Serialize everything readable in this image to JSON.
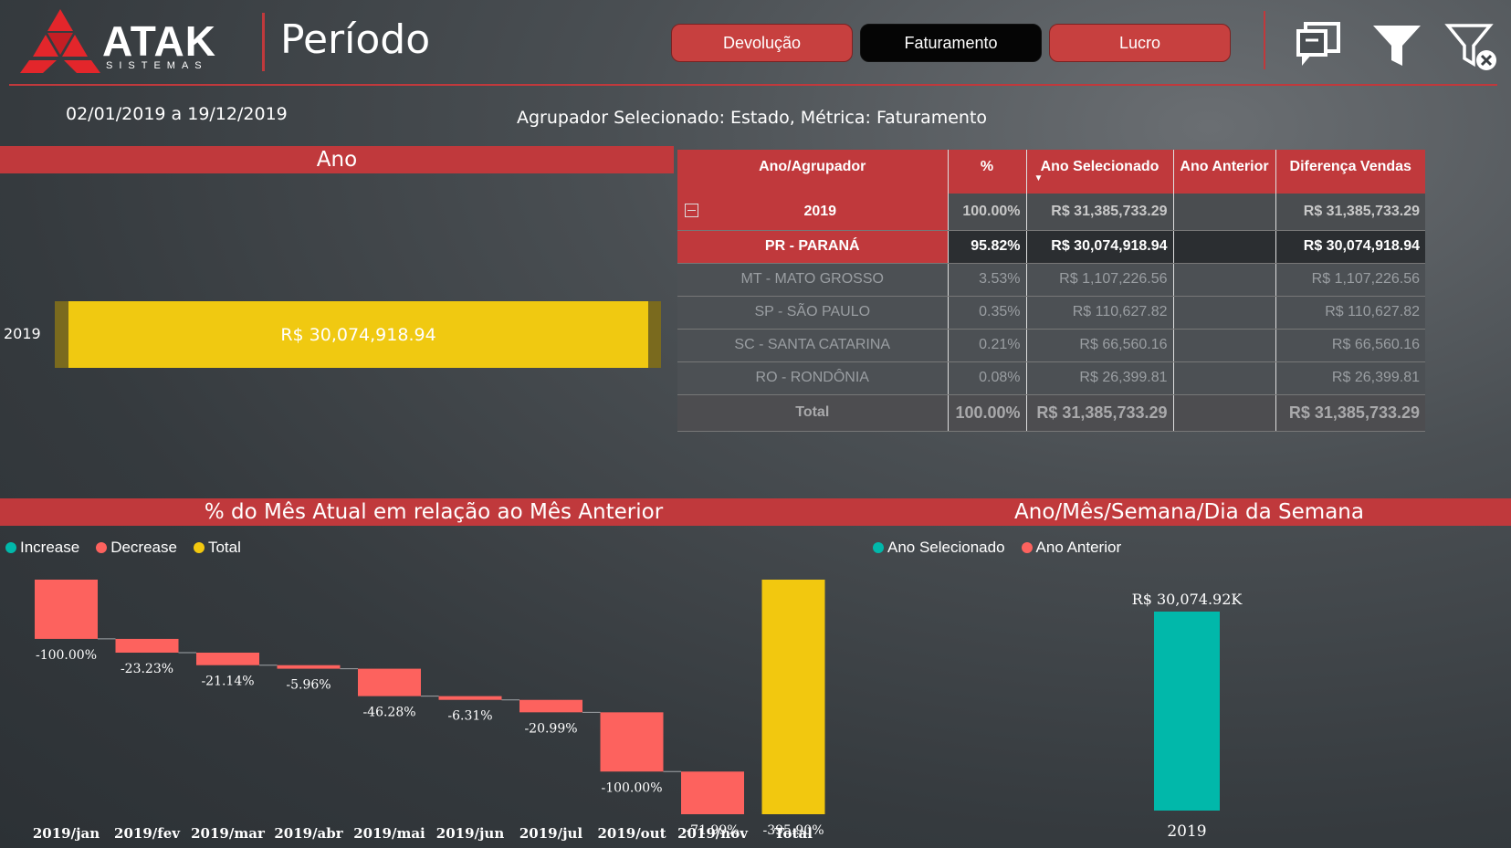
{
  "header": {
    "logo_name": "ATAK",
    "logo_sub": "SISTEMAS",
    "page_title": "Período",
    "buttons": [
      {
        "label": "Devolução",
        "active": false
      },
      {
        "label": "Faturamento",
        "active": true
      },
      {
        "label": "Lucro",
        "active": false
      }
    ],
    "icons": [
      "comment-icon",
      "filter-icon",
      "clear-filter-icon"
    ]
  },
  "info": {
    "date_range": "02/01/2019 a 19/12/2019",
    "selection": "Agrupador Selecionado: Estado, Métrica: Faturamento"
  },
  "ano_section": {
    "title": "Ano",
    "category": "2019",
    "value_label": "R$ 30,074,918.94"
  },
  "table": {
    "headers": [
      "Ano/Agrupador",
      "%",
      "Ano Selecionado",
      "Ano Anterior",
      "Diferença Vendas"
    ],
    "rows": [
      {
        "agr": "2019",
        "pct": "100.00%",
        "sel": "R$ 31,385,733.29",
        "ant": "",
        "dif": "R$ 31,385,733.29",
        "kind": "total2019"
      },
      {
        "agr": "PR - PARANÁ",
        "pct": "95.82%",
        "sel": "R$ 30,074,918.94",
        "ant": "",
        "dif": "R$ 30,074,918.94",
        "kind": "pr"
      },
      {
        "agr": "MT - MATO GROSSO",
        "pct": "3.53%",
        "sel": "R$ 1,107,226.56",
        "ant": "",
        "dif": "R$ 1,107,226.56",
        "kind": "dim"
      },
      {
        "agr": "SP - SÃO PAULO",
        "pct": "0.35%",
        "sel": "R$ 110,627.82",
        "ant": "",
        "dif": "R$ 110,627.82",
        "kind": "dim"
      },
      {
        "agr": "SC - SANTA CATARINA",
        "pct": "0.21%",
        "sel": "R$ 66,560.16",
        "ant": "",
        "dif": "R$ 66,560.16",
        "kind": "dim"
      },
      {
        "agr": "RO - RONDÔNIA",
        "pct": "0.08%",
        "sel": "R$ 26,399.81",
        "ant": "",
        "dif": "R$ 26,399.81",
        "kind": "dim"
      },
      {
        "agr": "Total",
        "pct": "100.00%",
        "sel": "R$ 31,385,733.29",
        "ant": "",
        "dif": "R$ 31,385,733.29",
        "kind": "grand"
      }
    ]
  },
  "waterfall": {
    "title": "% do Mês Atual em relação ao Mês Anterior",
    "legend": [
      {
        "label": "Increase",
        "color": "#01b8aa"
      },
      {
        "label": "Decrease",
        "color": "#fd625e"
      },
      {
        "label": "Total",
        "color": "#f2c80f"
      }
    ]
  },
  "yearly": {
    "title": "Ano/Mês/Semana/Dia da Semana",
    "legend": [
      {
        "label": "Ano Selecionado",
        "color": "#01b8aa"
      },
      {
        "label": "Ano Anterior",
        "color": "#fd625e"
      }
    ]
  },
  "chart_data": [
    {
      "type": "bar",
      "title": "% do Mês Atual em relação ao Mês Anterior",
      "subtype": "waterfall",
      "categories": [
        "2019/jan",
        "2019/fev",
        "2019/mar",
        "2019/abr",
        "2019/mai",
        "2019/jun",
        "2019/jul",
        "2019/out",
        "2019/nov",
        "Total"
      ],
      "values": [
        -100.0,
        -23.23,
        -21.14,
        -5.96,
        -46.28,
        -6.31,
        -20.99,
        -100.0,
        -71.99,
        -395.9
      ],
      "labels": [
        "-100.00%",
        "-23.23%",
        "-21.14%",
        "-5.96%",
        "-46.28%",
        "-6.31%",
        "-20.99%",
        "-100.00%",
        "-71.99%",
        "-395.90%"
      ],
      "kinds": [
        "decrease",
        "decrease",
        "decrease",
        "decrease",
        "decrease",
        "decrease",
        "decrease",
        "decrease",
        "decrease",
        "total"
      ]
    },
    {
      "type": "bar",
      "title": "Ano/Mês/Semana/Dia da Semana",
      "categories": [
        "2019"
      ],
      "series": [
        {
          "name": "Ano Selecionado",
          "values": [
            30074.92
          ],
          "labels": [
            "R$ 30,074.92K"
          ]
        },
        {
          "name": "Ano Anterior",
          "values": [
            0
          ]
        }
      ]
    }
  ]
}
